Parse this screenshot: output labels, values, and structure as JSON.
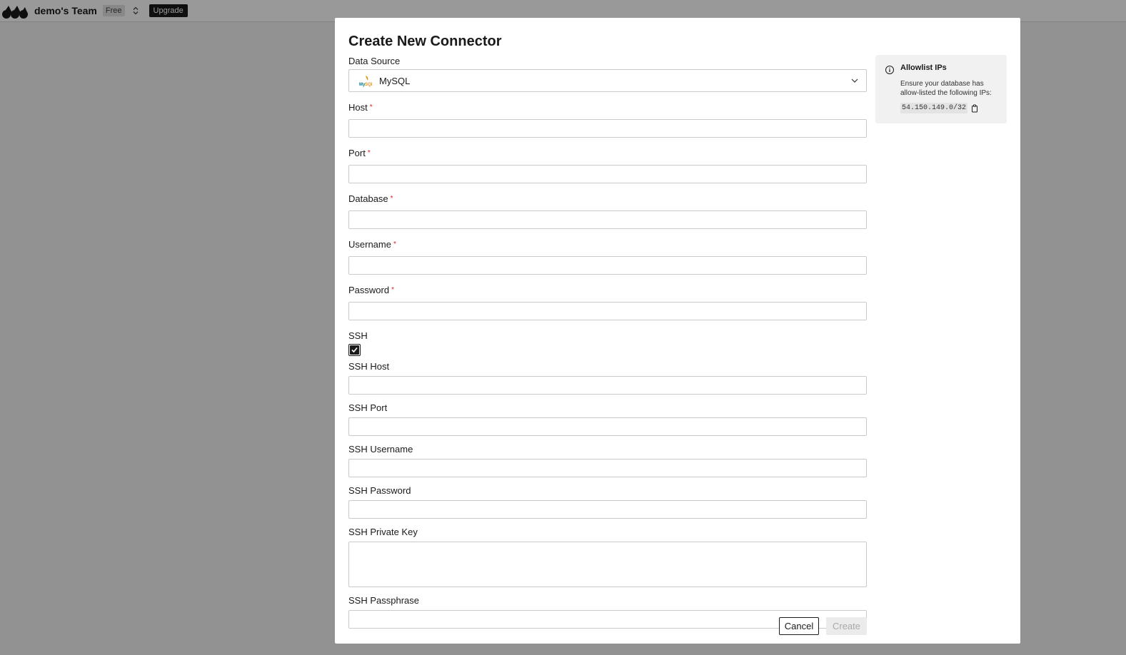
{
  "topbar": {
    "team_name": "demo's Team",
    "plan": "Free",
    "upgrade_label": "Upgrade"
  },
  "modal": {
    "title": "Create New Connector",
    "data_source": {
      "label": "Data Source",
      "value": "MySQL",
      "icon": "mysql-logo"
    },
    "fields": {
      "host": {
        "label": "Host",
        "required": "*",
        "value": ""
      },
      "port": {
        "label": "Port",
        "required": "*",
        "value": ""
      },
      "database": {
        "label": "Database",
        "required": "*",
        "value": ""
      },
      "username": {
        "label": "Username",
        "required": "*",
        "value": ""
      },
      "password": {
        "label": "Password",
        "required": "*",
        "value": ""
      },
      "ssh": {
        "label": "SSH",
        "checked": true
      },
      "ssh_host": {
        "label": "SSH Host",
        "value": ""
      },
      "ssh_port": {
        "label": "SSH Port",
        "value": ""
      },
      "ssh_username": {
        "label": "SSH Username",
        "value": ""
      },
      "ssh_password": {
        "label": "SSH Password",
        "value": ""
      },
      "ssh_private_key": {
        "label": "SSH Private Key",
        "value": ""
      },
      "ssh_passphrase": {
        "label": "SSH Passphrase",
        "value": ""
      }
    },
    "allowlist": {
      "title": "Allowlist IPs",
      "description": "Ensure your database has allow-listed the following IPs:",
      "ip": "54.150.149.0/32"
    },
    "buttons": {
      "cancel": "Cancel",
      "create": "Create"
    }
  },
  "colors": {
    "accent": "#1a1a1a",
    "required": "#dd2222",
    "overlay": "rgba(0,0,0,0.40)",
    "disabled_text": "#a9a9a9"
  }
}
